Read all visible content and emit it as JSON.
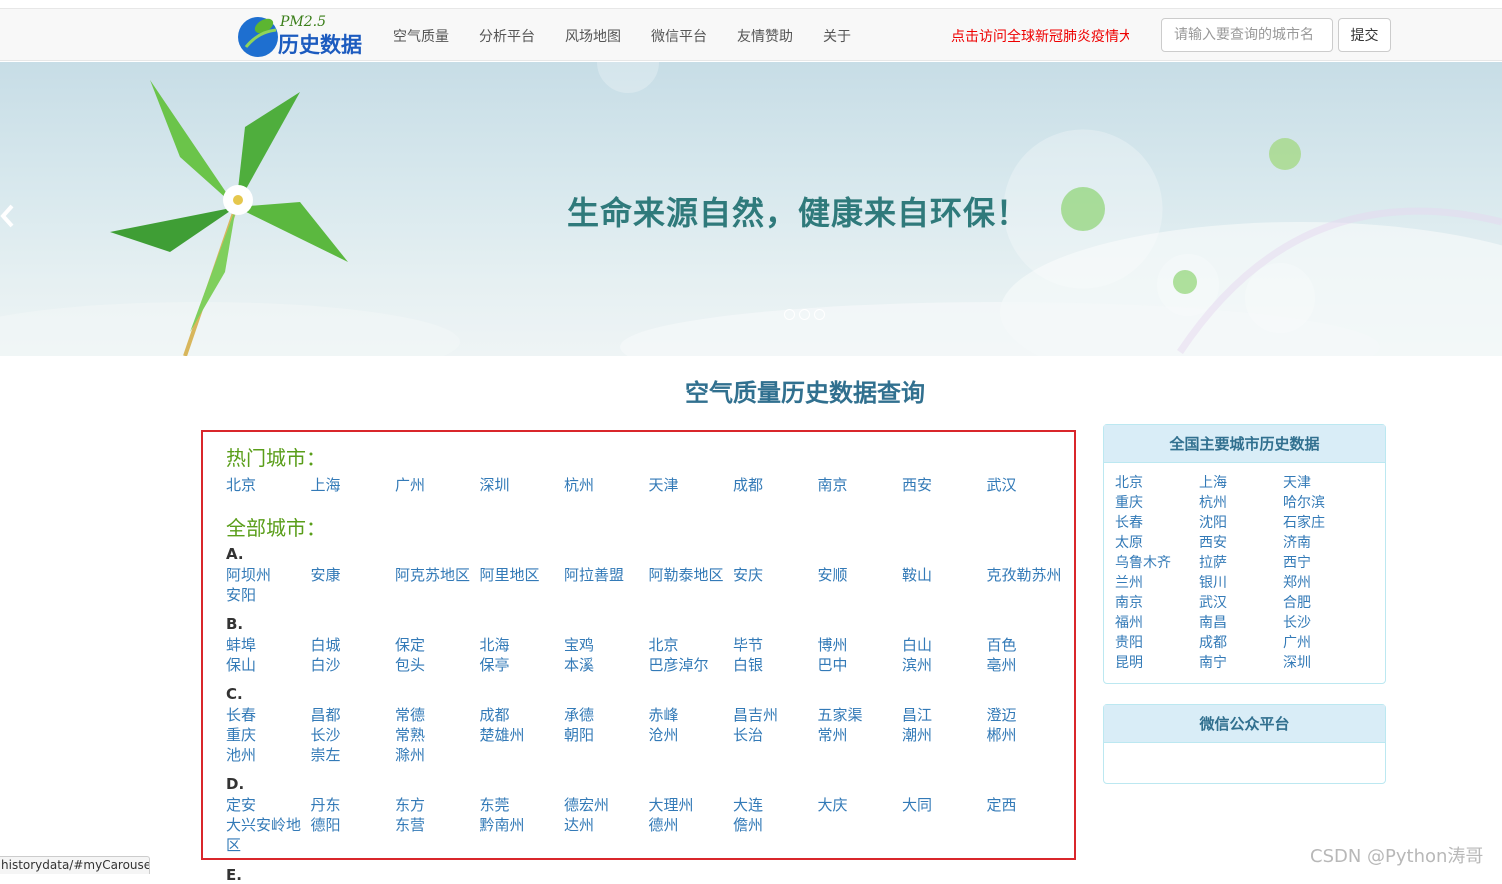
{
  "brand": {
    "logo_top": "PM2.5",
    "logo_text": "历史数据"
  },
  "nav": {
    "items": [
      "空气质量",
      "分析平台",
      "风场地图",
      "微信平台",
      "友情赞助",
      "关于"
    ],
    "notice": "点击访问全球新冠肺炎疫情大",
    "search_placeholder": "请输入要查询的城市名",
    "submit_label": "提交"
  },
  "carousel": {
    "slogan": "生命来源自然，健康来自环保！",
    "slide_count": 3,
    "active_slide": 1
  },
  "main": {
    "title": "空气质量历史数据查询",
    "hot_title": "热门城市：",
    "hot_cities": [
      "北京",
      "上海",
      "广州",
      "深圳",
      "杭州",
      "天津",
      "成都",
      "南京",
      "西安",
      "武汉"
    ],
    "all_title": "全部城市：",
    "groups": [
      {
        "letter": "A.",
        "cities": [
          "阿坝州",
          "安康",
          "阿克苏地区",
          "阿里地区",
          "阿拉善盟",
          "阿勒泰地区",
          "安庆",
          "安顺",
          "鞍山",
          "克孜勒苏州",
          "安阳"
        ]
      },
      {
        "letter": "B.",
        "cities": [
          "蚌埠",
          "白城",
          "保定",
          "北海",
          "宝鸡",
          "北京",
          "毕节",
          "博州",
          "白山",
          "百色",
          "保山",
          "白沙",
          "包头",
          "保亭",
          "本溪",
          "巴彦淖尔",
          "白银",
          "巴中",
          "滨州",
          "亳州"
        ]
      },
      {
        "letter": "C.",
        "cities": [
          "长春",
          "昌都",
          "常德",
          "成都",
          "承德",
          "赤峰",
          "昌吉州",
          "五家渠",
          "昌江",
          "澄迈",
          "重庆",
          "长沙",
          "常熟",
          "楚雄州",
          "朝阳",
          "沧州",
          "长治",
          "常州",
          "潮州",
          "郴州",
          "池州",
          "崇左",
          "滁州"
        ]
      },
      {
        "letter": "D.",
        "cities": [
          "定安",
          "丹东",
          "东方",
          "东莞",
          "德宏州",
          "大理州",
          "大连",
          "大庆",
          "大同",
          "定西",
          "大兴安岭地区",
          "德阳",
          "东营",
          "黔南州",
          "达州",
          "德州",
          "儋州"
        ]
      }
    ],
    "next_letter": "E."
  },
  "sidebar": {
    "main_cities_title": "全国主要城市历史数据",
    "main_cities": [
      "北京",
      "上海",
      "天津",
      "重庆",
      "杭州",
      "哈尔滨",
      "长春",
      "沈阳",
      "石家庄",
      "太原",
      "西安",
      "济南",
      "乌鲁木齐",
      "拉萨",
      "西宁",
      "兰州",
      "银川",
      "郑州",
      "南京",
      "武汉",
      "合肥",
      "福州",
      "南昌",
      "长沙",
      "贵阳",
      "成都",
      "广州",
      "昆明",
      "南宁",
      "深圳"
    ],
    "wechat_title": "微信公众平台"
  },
  "status_url": "historydata/#myCarousel",
  "watermark": "CSDN @Python涛哥",
  "colors": {
    "link": "#337ab7",
    "heading": "#31708f",
    "group_title": "#5a9e1a",
    "highlight_border": "#d9262b",
    "notice": "#e00000"
  }
}
